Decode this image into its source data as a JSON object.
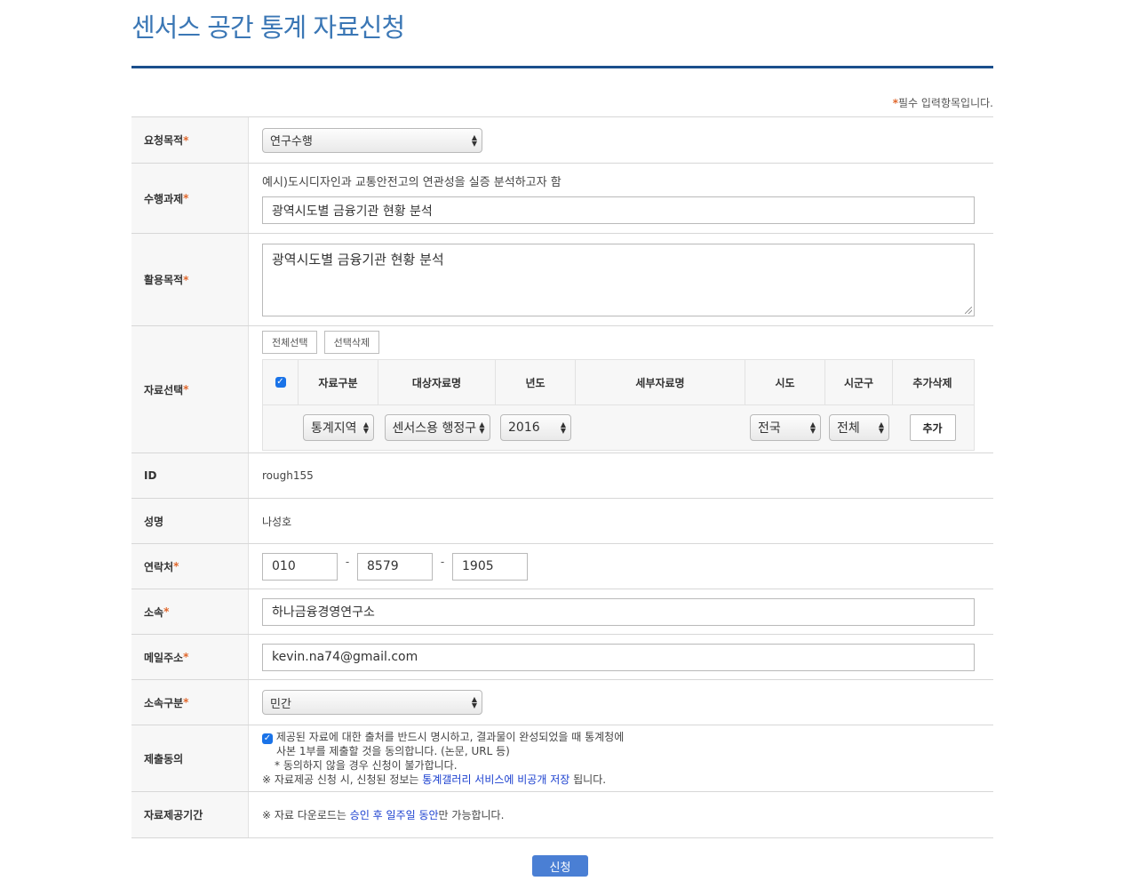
{
  "page": {
    "title": "센서스 공간 통계 자료신청",
    "required_note": "필수 입력항목입니다."
  },
  "fields": {
    "purpose": {
      "label": "요청목적",
      "value": "연구수행"
    },
    "task": {
      "label": "수행과제",
      "hint": "예시)도시디자인과 교통안전고의 연관성을 실증 분석하고자 함",
      "value": "광역시도별 금융기관 현황 분석"
    },
    "usage": {
      "label": "활용목적",
      "value": "광역시도별 금융기관 현황 분석"
    },
    "data_select": {
      "label": "자료선택",
      "select_all": "전체선택",
      "delete_selected": "선택삭제",
      "columns": [
        "자료구분",
        "대상자료명",
        "년도",
        "세부자료명",
        "시도",
        "시군구",
        "추가삭제"
      ],
      "row": {
        "category": "통계지역",
        "dataset": "센서스용 행정구",
        "year": "2016",
        "sido": "전국",
        "sigungu": "전체",
        "add_label": "추가"
      }
    },
    "id": {
      "label": "ID",
      "value": "rough155"
    },
    "name": {
      "label": "성명",
      "value": "나성호"
    },
    "phone": {
      "label": "연락처",
      "p1": "010",
      "p2": "8579",
      "p3": "1905",
      "sep": "-"
    },
    "affiliation": {
      "label": "소속",
      "value": "하나금융경영연구소"
    },
    "email": {
      "label": "메일주소",
      "value": "kevin.na74@gmail.com"
    },
    "affiliation_type": {
      "label": "소속구분",
      "value": "민간"
    },
    "consent": {
      "label": "제출동의",
      "line1": "제공된 자료에 대한 출처를 반드시 명시하고, 결과물이 완성되었을 때 통계청에",
      "line2": "사본 1부를 제출할 것을 동의합니다. (논문, URL 등)",
      "line3": "* 동의하지 않을 경우 신청이 불가합니다.",
      "line4_pre": "※ 자료제공 신청 시, 신청된 정보는 ",
      "line4_link": "통계갤러리 서비스에 비공개 저장",
      "line4_post": " 됩니다."
    },
    "period": {
      "label": "자료제공기간",
      "pre": "※ 자료 다운로드는 ",
      "link": "승인 후 일주일 동안",
      "post": "만 가능합니다."
    }
  },
  "submit_label": "신청",
  "colors": {
    "title": "#3b77b5",
    "rule": "#1b4f8c",
    "required": "#e0672c",
    "submit": "#4a7fd4",
    "link": "#1a3fcf"
  },
  "icons": {
    "checkbox": "checkbox-checked-icon",
    "select": "select-arrows-icon"
  }
}
